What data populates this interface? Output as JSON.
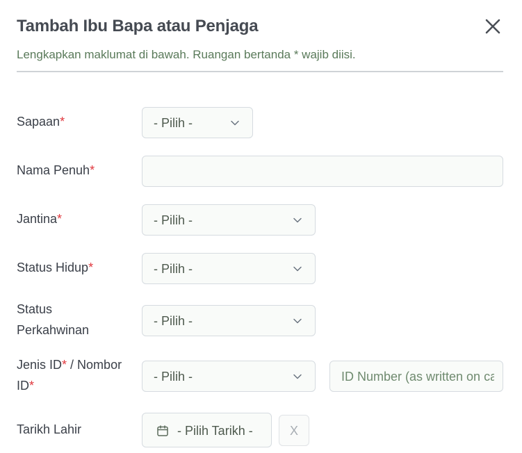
{
  "header": {
    "title": "Tambah Ibu Bapa atau Penjaga",
    "subtitle": "Lengkapkan maklumat di bawah. Ruangan bertanda * wajib diisi.",
    "close_icon": "close-icon"
  },
  "form": {
    "salutation": {
      "label": "Sapaan",
      "required_mark": "*",
      "value": "- Pilih -"
    },
    "full_name": {
      "label": "Nama Penuh",
      "required_mark": "*",
      "value": ""
    },
    "gender": {
      "label": "Jantina",
      "required_mark": "*",
      "value": "- Pilih -"
    },
    "living_status": {
      "label": "Status Hidup",
      "required_mark": "*",
      "value": "- Pilih -"
    },
    "marital_status": {
      "label_line1": "Status",
      "label_line2": "Perkahwinan",
      "value": "- Pilih -"
    },
    "id_type": {
      "label_part1": "Jenis ID",
      "required_mark1": "*",
      "label_part2": " / Nombor",
      "label_part3": "ID",
      "required_mark2": "*",
      "value": "- Pilih -",
      "id_number_placeholder": "ID Number (as written on card)"
    },
    "birth_date": {
      "label": "Tarikh Lahir",
      "button_label": "- Pilih Tarikh -",
      "clear_label": "X",
      "icon": "calendar-icon"
    }
  },
  "colors": {
    "required": "#e0383e",
    "subtitle": "#5a7a5a",
    "field_border": "#d6dbe0",
    "field_bg": "#f9fbf9"
  }
}
